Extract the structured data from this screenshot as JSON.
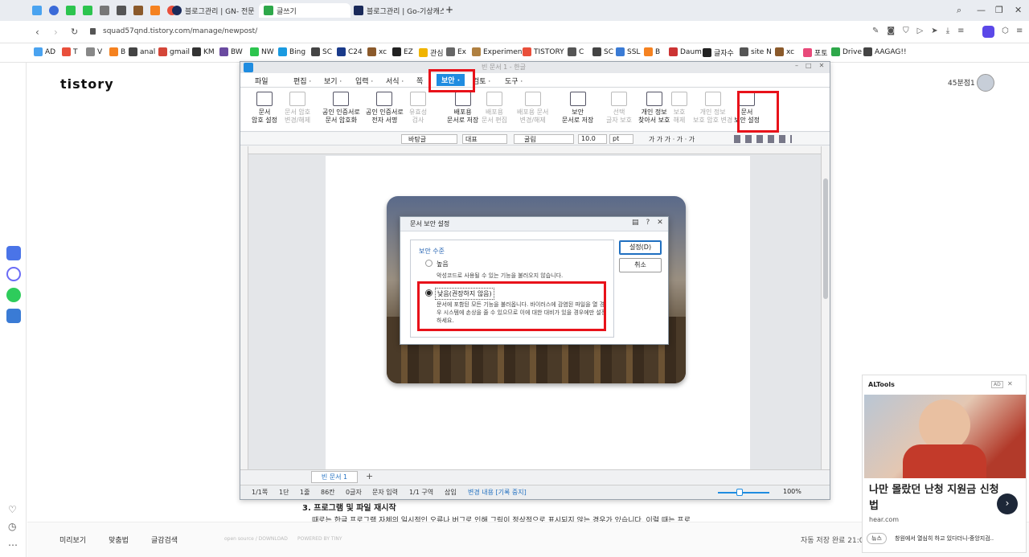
{
  "browser": {
    "tabs": [
      {
        "label": "블로그관리 | GN- 전문 ",
        "color": "#1a2a5a"
      },
      {
        "label": "글쓰기",
        "color": "#2ea84a",
        "active": true
      },
      {
        "label": "블로그관리 | Go-기상캐스",
        "color": "#1a2a5a"
      }
    ],
    "new_tab": "+",
    "url": "squad57qnd.tistory.com/manage/newpost/",
    "bookmarks": [
      "AD",
      "T",
      "V",
      "B",
      "anal",
      "gmail",
      "KM",
      "BW",
      "NW",
      "Bing",
      "SC",
      "C24",
      "xc",
      "EZ",
      "관심",
      "Ex",
      "Experiments",
      "TISTORY",
      "C",
      "SC",
      "SSL",
      "B",
      "Daum",
      "글자수",
      "site N",
      "xc",
      "포토",
      "Drive",
      "AAGAG!!"
    ]
  },
  "tistory": {
    "logo": "tistory",
    "blog_name": "45분점1",
    "heading": "3. 프로그램 및 파일 재시작",
    "body_text": "때로는 한글 프로그램 자체의 일시적인 오류나 버그로 인해 그림이 정상적으로 표시되지 않는 경우가 있습니다. 이럴 때는 프로",
    "bottom_buttons": [
      "미리보기",
      "맞춤법",
      "글감검색"
    ],
    "footer_links": [
      "open source / DOWNLOAD",
      "POWERED BY TINY"
    ],
    "autosave": "자동 저장 완료 21:06"
  },
  "hwp": {
    "title": "빈 문서 1 - 한글",
    "menus": [
      "파일",
      "편집",
      "보기",
      "입력",
      "서식",
      "쪽",
      "보안",
      "검토",
      "도구"
    ],
    "active_menu": "보안",
    "ribbon": [
      {
        "label": "문서\n암호 설정",
        "enabled": true
      },
      {
        "label": "문서 암호\n변경/해제",
        "enabled": false
      },
      {
        "label": "공인 인증서로\n문서 암호화",
        "enabled": true
      },
      {
        "label": "공인 인증서로\n전자 서명",
        "enabled": true
      },
      {
        "label": "유효성\n검사",
        "enabled": false
      },
      {
        "label": "배포용\n문서로 저장",
        "enabled": true
      },
      {
        "label": "배포용\n문서 편집",
        "enabled": false
      },
      {
        "label": "배포용 문서\n변경/해제",
        "enabled": false
      },
      {
        "label": "보안\n문서로 저장",
        "enabled": true
      },
      {
        "label": "선택\n글자 보호",
        "enabled": false
      },
      {
        "label": "개인 정보\n찾아서 보호",
        "enabled": true
      },
      {
        "label": "보호\n해제",
        "enabled": false
      },
      {
        "label": "개인 정보\n보호 암호 변경",
        "enabled": false
      },
      {
        "label": "문서\n보안 설정",
        "enabled": true
      }
    ],
    "toolbar": {
      "style": "바탕글",
      "lang": "대표",
      "font": "굴림",
      "size": "10.0",
      "unit": "pt"
    },
    "doc_tab": "빈 문서 1",
    "status": [
      "1/1쪽",
      "1단",
      "1줄",
      "86칸",
      "0글자",
      "문자 입력",
      "1/1 구역",
      "삽입",
      "변경 내용 [기록 중지]"
    ],
    "zoom": "100%"
  },
  "dialog": {
    "title": "문서 보안 설정",
    "group": "보안 수준",
    "option_high": "높음",
    "option_high_desc": "악성코드로 사용될 수 있는 기능을 불러오지 않습니다.",
    "option_low": "낮음(권장하지 않음)",
    "option_low_desc": "문서에 포함된 모든 기능을 불러옵니다. 바이러스에 감염된 파일을 열 경우 시스템에 손상을 줄 수 있으므로 이에 대한 대비가 있을 경우에만 설정하세요.",
    "selected": "low",
    "ok": "설정(D)",
    "cancel": "취소"
  },
  "ad": {
    "brand": "ALTools",
    "badge": "AD",
    "headline": "나만 몰랐던 난청 지원금 신청법",
    "domain": "hear.com",
    "news_tag": "뉴스",
    "news_text": "창원에서 열심히 하고 있다더니-중앙지검.."
  },
  "colors": {
    "accent": "#e8121a",
    "hwp_blue": "#1f8ce0",
    "opera_red": "#e0161d"
  }
}
